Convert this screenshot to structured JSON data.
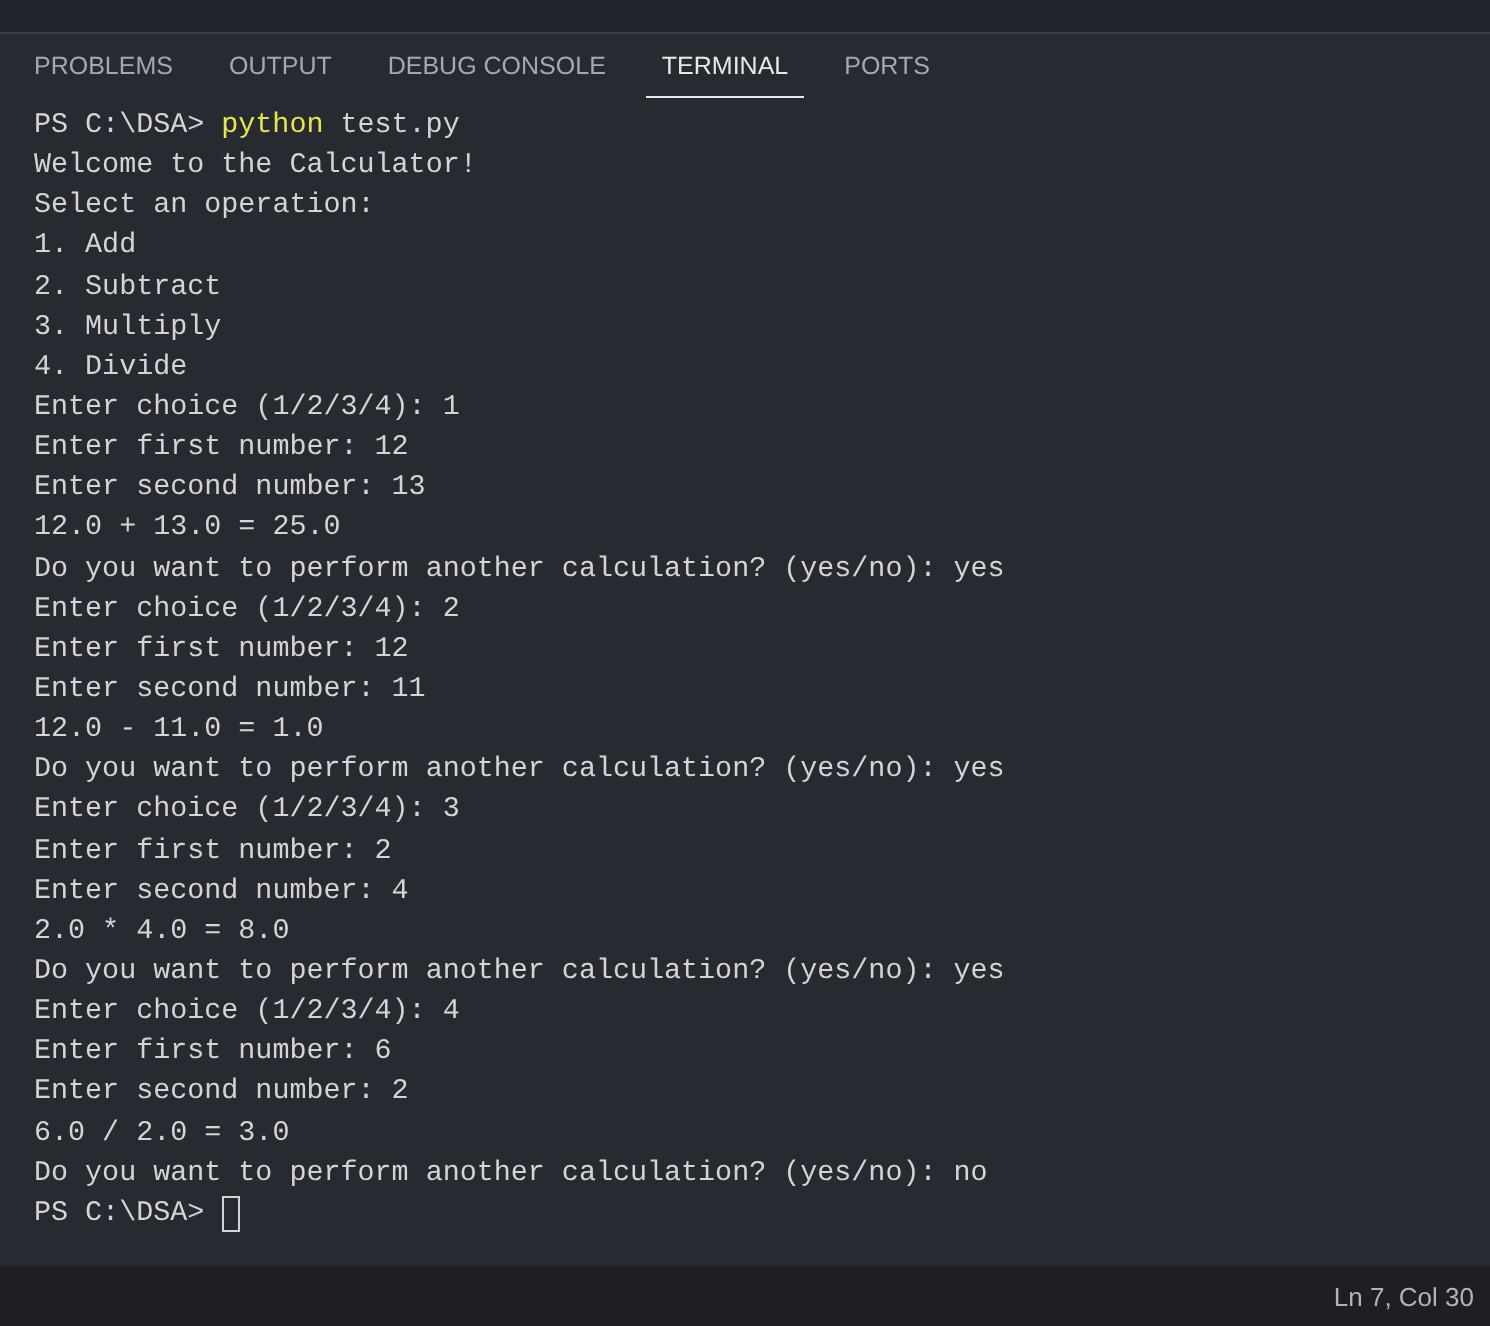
{
  "panel_tabs": [
    {
      "label": "PROBLEMS",
      "selected": false
    },
    {
      "label": "OUTPUT",
      "selected": false
    },
    {
      "label": "DEBUG CONSOLE",
      "selected": false
    },
    {
      "label": "TERMINAL",
      "selected": true
    },
    {
      "label": "PORTS",
      "selected": false
    }
  ],
  "terminal": {
    "lines": [
      {
        "kind": "command",
        "prompt": "PS C:\\DSA>",
        "program": "python",
        "args": "test.py"
      },
      {
        "kind": "output",
        "text": "Welcome to the Calculator!"
      },
      {
        "kind": "output",
        "text": "Select an operation:"
      },
      {
        "kind": "output",
        "text": "1. Add"
      },
      {
        "kind": "output",
        "text": "2. Subtract"
      },
      {
        "kind": "output",
        "text": "3. Multiply"
      },
      {
        "kind": "output",
        "text": "4. Divide"
      },
      {
        "kind": "output",
        "text": "Enter choice (1/2/3/4): 1"
      },
      {
        "kind": "output",
        "text": "Enter first number: 12"
      },
      {
        "kind": "output",
        "text": "Enter second number: 13"
      },
      {
        "kind": "output",
        "text": "12.0 + 13.0 = 25.0"
      },
      {
        "kind": "output",
        "text": "Do you want to perform another calculation? (yes/no): yes"
      },
      {
        "kind": "output",
        "text": "Enter choice (1/2/3/4): 2"
      },
      {
        "kind": "output",
        "text": "Enter first number: 12"
      },
      {
        "kind": "output",
        "text": "Enter second number: 11"
      },
      {
        "kind": "output",
        "text": "12.0 - 11.0 = 1.0"
      },
      {
        "kind": "output",
        "text": "Do you want to perform another calculation? (yes/no): yes"
      },
      {
        "kind": "output",
        "text": "Enter choice (1/2/3/4): 3"
      },
      {
        "kind": "output",
        "text": "Enter first number: 2"
      },
      {
        "kind": "output",
        "text": "Enter second number: 4"
      },
      {
        "kind": "output",
        "text": "2.0 * 4.0 = 8.0"
      },
      {
        "kind": "output",
        "text": "Do you want to perform another calculation? (yes/no): yes"
      },
      {
        "kind": "output",
        "text": "Enter choice (1/2/3/4): 4"
      },
      {
        "kind": "output",
        "text": "Enter first number: 6"
      },
      {
        "kind": "output",
        "text": "Enter second number: 2"
      },
      {
        "kind": "output",
        "text": "6.0 / 2.0 = 3.0"
      },
      {
        "kind": "output",
        "text": "Do you want to perform another calculation? (yes/no): no"
      },
      {
        "kind": "prompt",
        "prompt": "PS C:\\DSA>",
        "cursor": true
      }
    ]
  },
  "status_bar": {
    "position": "Ln 7, Col 30"
  }
}
